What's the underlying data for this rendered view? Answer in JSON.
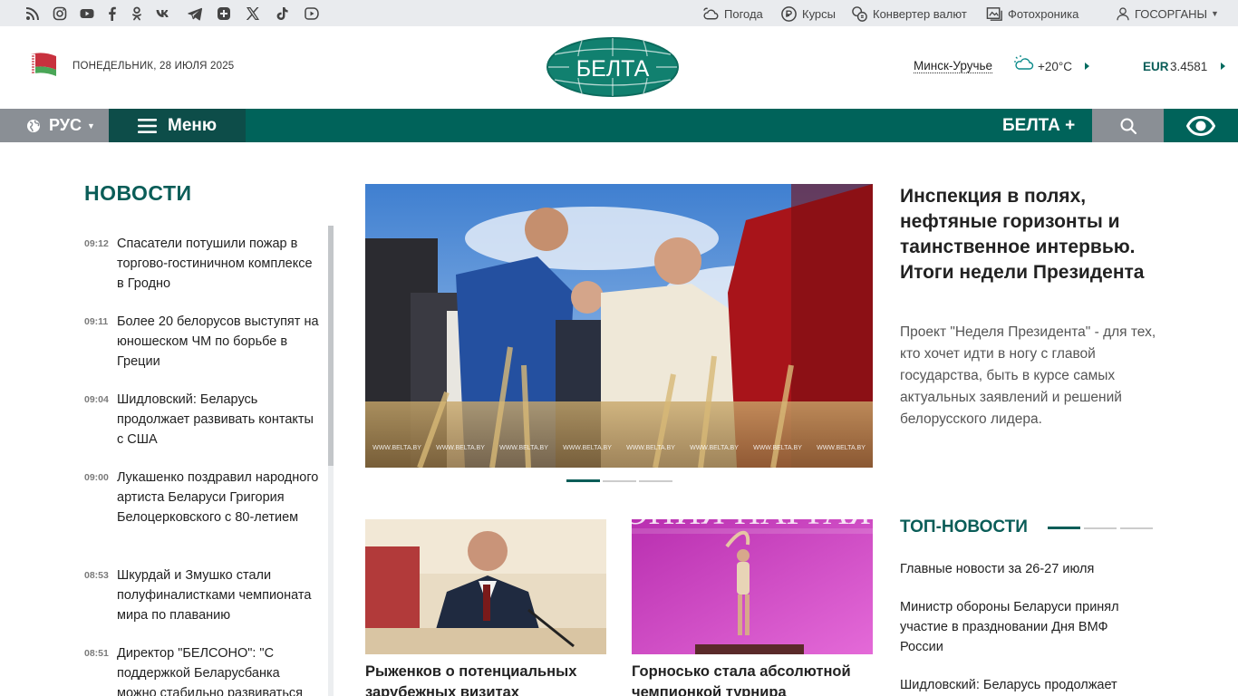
{
  "topbar": {
    "socials": [
      "rss-icon",
      "instagram-icon",
      "youtube-icon",
      "facebook-icon",
      "odnoklassniki-icon",
      "vk-icon",
      "telegram-icon",
      "max-icon",
      "x-icon",
      "tiktok-icon",
      "rutube-icon"
    ],
    "links": {
      "weather": "Погода",
      "rates": "Курсы",
      "converter": "Конвертер валют",
      "photo": "Фотохроника",
      "gov": "ГОСОРГАНЫ"
    }
  },
  "header": {
    "date": "ПОНЕДЕЛЬНИК, 28 ИЮЛЯ 2025",
    "logo_text": "БЕЛТА",
    "city": "Минск-Уручье",
    "temperature": "+20°C",
    "currency_code": "EUR",
    "currency_value": "3.4581"
  },
  "nav": {
    "lang": "РУС",
    "menu": "Меню",
    "plus": "БЕЛТА +"
  },
  "news": {
    "title": "НОВОСТИ",
    "items": [
      {
        "time": "09:12",
        "text": "Спасатели потушили пожар в торгово-гостиничном комплексе в Гродно"
      },
      {
        "time": "09:11",
        "text": "Более 20 белорусов выступят на юношеском ЧМ по борьбе в Греции"
      },
      {
        "time": "09:04",
        "text": "Шидловский: Беларусь продолжает развивать контакты с США"
      },
      {
        "time": "09:00",
        "text": "Лукашенко поздравил народного артиста Беларуси Григория Белоцерковского с 80-летием"
      },
      {
        "time": "08:53",
        "text": "Шкурдай и Змушко стали полуфиналистками чемпионата мира по плаванию"
      },
      {
        "time": "08:51",
        "text": "Директор \"БЕЛСОНО\": \"С поддержкой Беларусбанка можно стабильно развиваться"
      }
    ]
  },
  "hero": {
    "watermark": "WWW.BELTA.BY",
    "title": "Инспекция в полях, нефтяные горизонты и таинственное интервью. Итоги недели Президента",
    "lead": "Проект \"Неделя Президента\" - для тех, кто хочет идти в ногу с главой государства, быть в курсе самых актуальных заявлений и решений белорусского лидера."
  },
  "cards": [
    {
      "title": "Рыженков о потенциальных зарубежных визитах"
    },
    {
      "title": "Горносько стала абсолютной чемпионкой турнира",
      "image_text": "ЦЕРЕМОНИЯ НАГРАЖДЕНИЯ"
    }
  ],
  "top_news": {
    "title": "ТОП-НОВОСТИ",
    "items": [
      "Главные новости за 26-27 июля",
      "Министр обороны Беларуси принял участие в праздновании Дня ВМФ России",
      "Шидловский: Беларусь продолжает"
    ]
  },
  "colors": {
    "brand": "#00635a",
    "brand_dark": "#0d4d49",
    "gray_button": "#8a8f95"
  }
}
